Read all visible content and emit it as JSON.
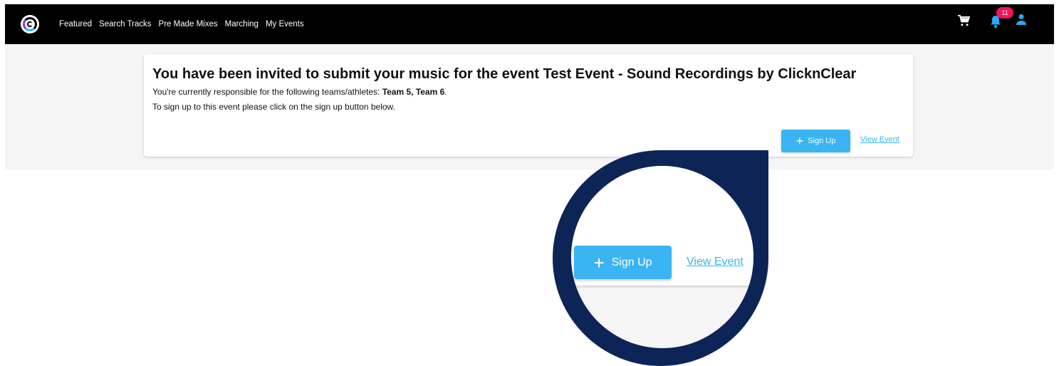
{
  "nav": {
    "links": [
      "Featured",
      "Search Tracks",
      "Pre Made Mixes",
      "Marching",
      "My Events"
    ],
    "notification_count": "11"
  },
  "invite": {
    "title": "You have been invited to submit your music for the event Test Event - Sound Recordings by ClicknClear",
    "responsible_prefix": "You're currently responsible for the following teams/athletes: ",
    "teams": "Team 5, Team 6",
    "responsible_suffix": ".",
    "instruction": "To sign up to this event please click on the sign up button below.",
    "signup_label": "Sign Up",
    "view_event_label": "View Event"
  },
  "colors": {
    "accent": "#3ab4f2",
    "badge": "#f4145a",
    "callout": "#0d2457"
  }
}
